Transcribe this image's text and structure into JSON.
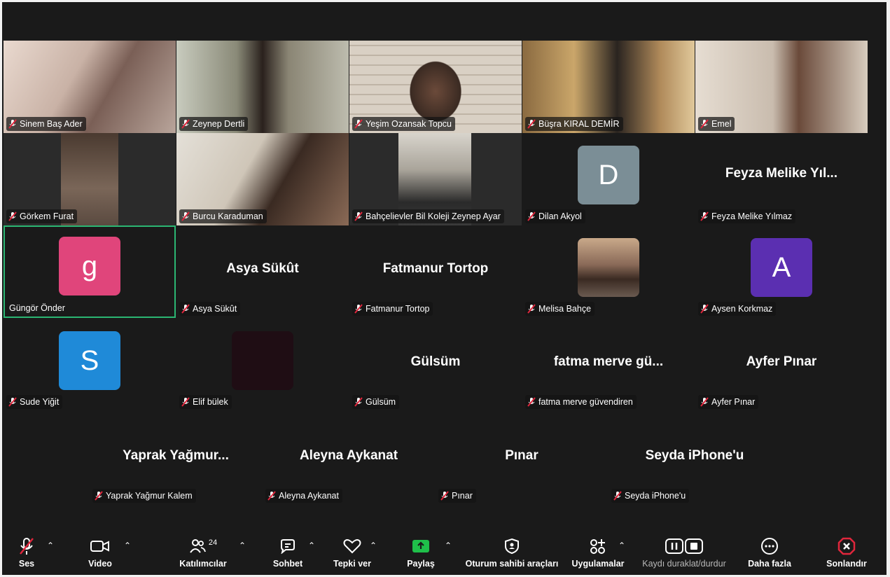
{
  "participants": {
    "r1": [
      {
        "name": "Sinem Baş Ader"
      },
      {
        "name": "Zeynep Dertli"
      },
      {
        "name": "Yeşim Ozansak Topcu"
      },
      {
        "name": "Büşra KIRAL DEMİR"
      },
      {
        "name": "Emel"
      }
    ],
    "r2": [
      {
        "name": "Görkem Furat"
      },
      {
        "name": "Burcu Karaduman"
      },
      {
        "name": "Bahçelievler Bil Koleji  Zeynep Ayar"
      },
      {
        "name": "Dilan Akyol",
        "initial": "D",
        "color": "#7b8e96"
      },
      {
        "name": "Feyza Melike Yılmaz",
        "display": "Feyza  Melike  Yıl..."
      }
    ],
    "r3": [
      {
        "name": "Güngör Önder",
        "initial": "g",
        "color": "#e0457b"
      },
      {
        "name": "Asya Sükût",
        "display": "Asya Sükût"
      },
      {
        "name": "Fatmanur Tortop",
        "display": "Fatmanur Tortop"
      },
      {
        "name": "Melisa Bahçe"
      },
      {
        "name": "Aysen Korkmaz",
        "initial": "A",
        "color": "#5b2fb1"
      }
    ],
    "r4": [
      {
        "name": "Sude Yiğit",
        "initial": "S",
        "color": "#1f8ad8"
      },
      {
        "name": "Elif bülek"
      },
      {
        "name": "Gülsüm",
        "display": "Gülsüm"
      },
      {
        "name": "fatma merve güvendiren",
        "display": "fatma  merve  gü..."
      },
      {
        "name": "Ayfer Pınar",
        "display": "Ayfer Pınar"
      }
    ],
    "r5": [
      {
        "name": "Yaprak Yağmur Kalem",
        "display": "Yaprak  Yağmur..."
      },
      {
        "name": "Aleyna Aykanat",
        "display": "Aleyna Aykanat"
      },
      {
        "name": "Pınar",
        "display": "Pınar"
      },
      {
        "name": "Seyda iPhone'u",
        "display": "Seyda iPhone'u"
      }
    ]
  },
  "toolbar": {
    "ses": "Ses",
    "video": "Video",
    "katilimcilar": "Katılımcılar",
    "katilimci_sayisi": "24",
    "sohbet": "Sohbet",
    "tepki": "Tepki ver",
    "paylas": "Paylaş",
    "oturum": "Oturum sahibi araçları",
    "uygulamalar": "Uygulamalar",
    "kayit": "Kaydı duraklat/durdur",
    "daha": "Daha fazla",
    "sonlandir": "Sonlandır"
  },
  "colors": {
    "accent_green": "#2bb673",
    "share_green": "#1fbf4a",
    "end_red": "#e0263c",
    "mic_off_red": "#e0263c"
  }
}
